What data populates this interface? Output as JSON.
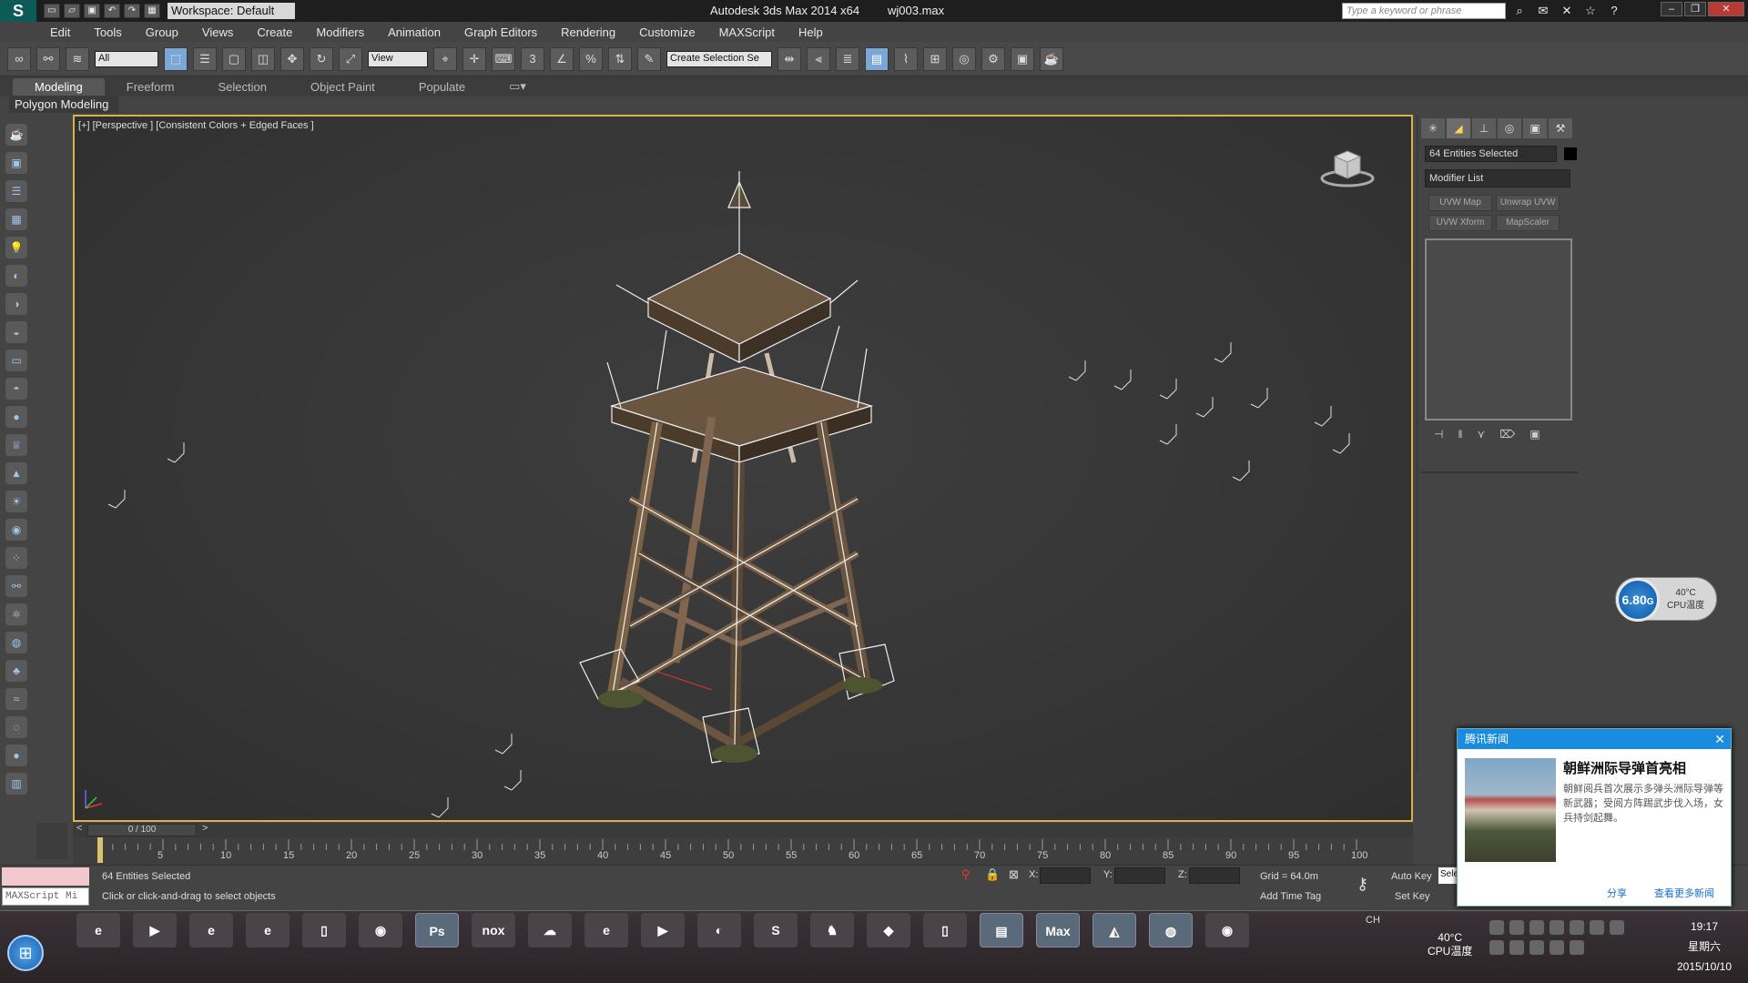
{
  "titlebar": {
    "workspace": "Workspace: Default",
    "app_title": "Autodesk 3ds Max  2014 x64",
    "file_name": "wj003.max",
    "search_placeholder": "Type a keyword or phrase"
  },
  "menu": [
    "Edit",
    "Tools",
    "Group",
    "Views",
    "Create",
    "Modifiers",
    "Animation",
    "Graph Editors",
    "Rendering",
    "Customize",
    "MAXScript",
    "Help"
  ],
  "toolbar": {
    "filter_value": "All",
    "ref_coord_value": "View",
    "selection_set_placeholder": "Create Selection Se"
  },
  "ribbon": {
    "tabs": [
      "Modeling",
      "Freeform",
      "Selection",
      "Object Paint",
      "Populate"
    ],
    "active_tab": "Modeling",
    "sub_label": "Polygon Modeling"
  },
  "viewport": {
    "label": "[+] [Perspective ] [Consistent Colors + Edged Faces ]"
  },
  "command_panel": {
    "entities_selected": "64 Entities Selected",
    "modifier_list": "Modifier List",
    "buttons": [
      "UVW Map",
      "Unwrap UVW",
      "UVW Xform",
      "MapScaler"
    ]
  },
  "cpu_widget": {
    "value": "6.80",
    "unit": "G",
    "temp": "40°C",
    "label": "CPU温度"
  },
  "timeline": {
    "frame": "0 / 100",
    "ticks": [
      "0",
      "5",
      "10",
      "15",
      "20",
      "25",
      "30",
      "35",
      "40",
      "45",
      "50",
      "55",
      "60",
      "65",
      "70",
      "75",
      "80",
      "85",
      "90",
      "95",
      "100"
    ]
  },
  "status": {
    "maxscript_label": "MAXScript Mi",
    "selection": "64 Entities Selected",
    "prompt": "Click or click-and-drag to select objects",
    "x_label": "X:",
    "y_label": "Y:",
    "z_label": "Z:",
    "grid": "Grid = 64.0m",
    "add_time_tag": "Add Time Tag",
    "auto_key": "Auto Key",
    "set_key": "Set Key",
    "selected_box": "Sele"
  },
  "news_popup": {
    "header": "腾讯新闻",
    "title": "朝鲜洲际导弹首亮相",
    "body": "朝鲜阅兵首次展示多弹头洲际导弹等新武器；受阅方阵踢武步伐入场，女兵持剑起舞。",
    "share": "分享",
    "more": "查看更多新闻"
  },
  "taskbar": {
    "apps": [
      "e",
      "▶",
      "e",
      "e",
      "▯",
      "◉",
      "Ps",
      "nox",
      "☁",
      "e",
      "▶",
      "◐",
      "S",
      "♞",
      "◆",
      "▯",
      "▤",
      "Max",
      "◭",
      "◍",
      "◉"
    ],
    "lang": "CH",
    "tray_temp": "40°C",
    "tray_temp_label": "CPU温度",
    "time": "19:17",
    "weekday": "星期六",
    "date": "2015/10/10"
  }
}
